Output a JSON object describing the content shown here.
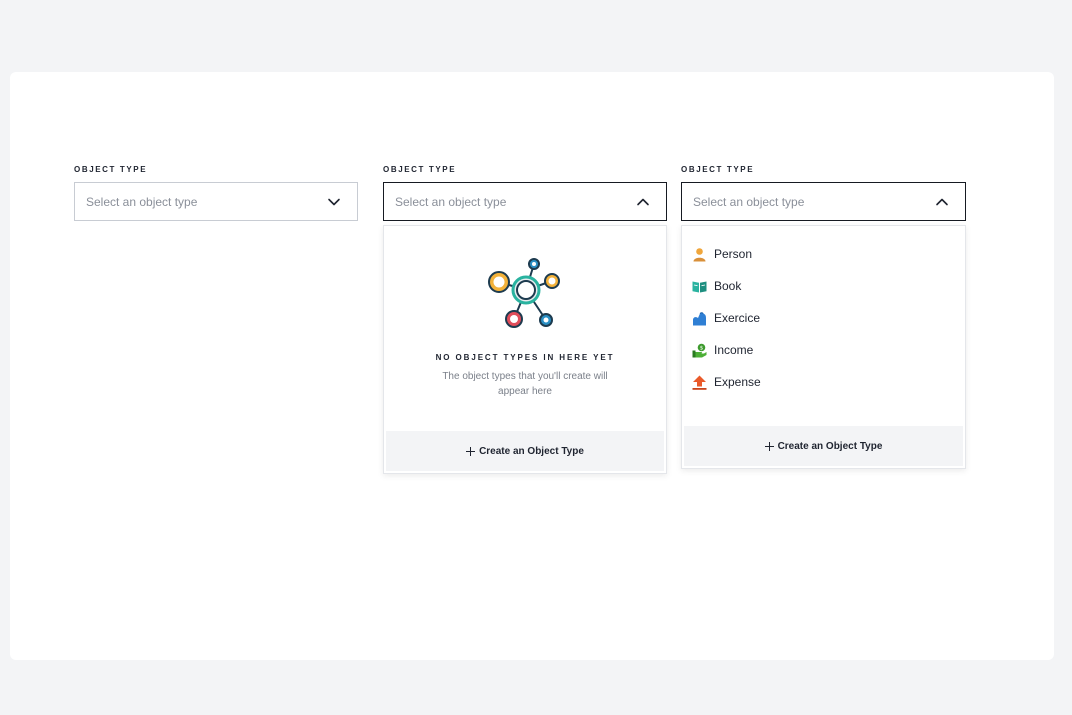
{
  "fields": [
    {
      "label": "Object type",
      "placeholder": "Select an object type",
      "state": "closed"
    },
    {
      "label": "Object type",
      "placeholder": "Select an object type",
      "state": "open-empty",
      "empty_state": {
        "title": "No object types in here yet",
        "description": "The object types that you'll create will appear here"
      },
      "footer_action": "Create an Object Type"
    },
    {
      "label": "Object type",
      "placeholder": "Select an object type",
      "state": "open-list",
      "options": [
        {
          "label": "Person",
          "icon": "person-icon"
        },
        {
          "label": "Book",
          "icon": "book-icon"
        },
        {
          "label": "Exercice",
          "icon": "flexed-arm-icon"
        },
        {
          "label": "Income",
          "icon": "money-hand-icon"
        },
        {
          "label": "Expense",
          "icon": "upload-arrow-icon"
        }
      ],
      "footer_action": "Create an Object Type"
    }
  ],
  "colors": {
    "page_background": "#f3f4f6",
    "card_background": "#ffffff",
    "active_border": "#161a22",
    "placeholder_text": "#8a8f99"
  }
}
